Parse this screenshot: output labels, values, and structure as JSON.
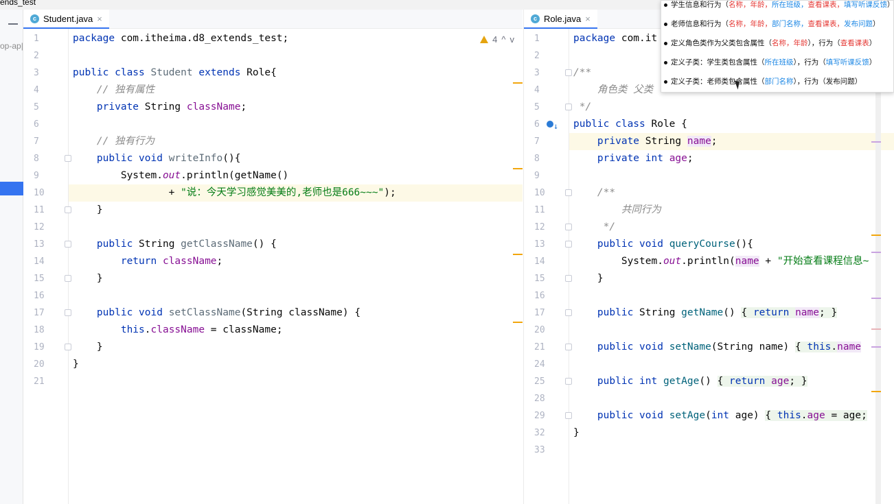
{
  "project_title": "ends_test",
  "left_strip": {
    "label": "op-ap|"
  },
  "left_editor": {
    "tab": {
      "icon": "c",
      "label": "Student.java",
      "close": "×"
    },
    "warnings": "4",
    "lines": [
      {
        "n": "1",
        "html": "<span class='kw'>package</span> com.itheima.d8_extends_test;"
      },
      {
        "n": "2",
        "html": ""
      },
      {
        "n": "3",
        "html": "<span class='kw'>public class</span> <span class='cls-grey'>Student</span> <span class='kw'>extends</span> Role{"
      },
      {
        "n": "4",
        "html": "    <span class='cmt'>// 独有属性</span>"
      },
      {
        "n": "5",
        "html": "    <span class='kw'>private</span> String <span class='fld'>className</span>;"
      },
      {
        "n": "6",
        "html": ""
      },
      {
        "n": "7",
        "html": "    <span class='cmt'>// 独有行为</span>"
      },
      {
        "n": "8",
        "html": "    <span class='kw'>public void</span> <span class='cls-grey'>writeInfo</span>(){"
      },
      {
        "n": "9",
        "html": "        System.<span class='ital'>out</span>.println(getName()"
      },
      {
        "n": "10",
        "html": "                + <span class='str'>\"说：今天学习感觉美美的,老师也是666~~~\"</span>);"
      },
      {
        "n": "11",
        "html": "    }"
      },
      {
        "n": "12",
        "html": ""
      },
      {
        "n": "13",
        "html": "    <span class='kw'>public</span> String <span class='cls-grey'>getClassName</span>() {"
      },
      {
        "n": "14",
        "html": "        <span class='kw'>return</span> <span class='fld'>className</span>;"
      },
      {
        "n": "15",
        "html": "    }"
      },
      {
        "n": "16",
        "html": ""
      },
      {
        "n": "17",
        "html": "    <span class='kw'>public void</span> <span class='cls-grey'>setClassName</span>(String className) {"
      },
      {
        "n": "18",
        "html": "        <span class='kw'>this</span>.<span class='fld'>className</span> = className;"
      },
      {
        "n": "19",
        "html": "    }"
      },
      {
        "n": "20",
        "html": "}"
      },
      {
        "n": "21",
        "html": ""
      }
    ]
  },
  "right_editor": {
    "tab": {
      "icon": "c",
      "label": "Role.java",
      "close": "×"
    },
    "lines": [
      {
        "n": "1",
        "html": "<span class='kw'>package</span> com.it"
      },
      {
        "n": "2",
        "html": ""
      },
      {
        "n": "3",
        "html": "<span class='cmt-doc'>/**</span>"
      },
      {
        "n": "4",
        "html": "<span class='cmt-doc'>    角色类 父类</span>"
      },
      {
        "n": "5",
        "html": "<span class='cmt-doc'> */</span>"
      },
      {
        "n": "6",
        "html": "<span class='kw'>public class</span> Role {"
      },
      {
        "n": "7",
        "html": "    <span class='kw'>private</span> String <span class='fld mark-bg'>name</span>;"
      },
      {
        "n": "8",
        "html": "    <span class='kw'>private int</span> <span class='fld'>age</span>;"
      },
      {
        "n": "9",
        "html": ""
      },
      {
        "n": "10",
        "html": "    <span class='cmt-doc'>/**</span>"
      },
      {
        "n": "11",
        "html": "<span class='cmt-doc'>        共同行为</span>"
      },
      {
        "n": "12",
        "html": "<span class='cmt-doc'>     */</span>"
      },
      {
        "n": "13",
        "html": "    <span class='kw'>public void</span> <span class='meth'>queryCourse</span>(){"
      },
      {
        "n": "14",
        "html": "        System.<span class='ital'>out</span>.println(<span class='fld mark-bg'>name</span> + <span class='str'>\"开始查看课程信息~</span>"
      },
      {
        "n": "15",
        "html": "    }"
      },
      {
        "n": "16",
        "html": ""
      },
      {
        "n": "17",
        "html": "    <span class='kw'>public</span> String <span class='meth'>getName</span>() <span class='fold-bg'>{ <span class='kw'>return</span> <span class='fld mark-bg'>name</span>; }</span>"
      },
      {
        "n": "20",
        "html": ""
      },
      {
        "n": "21",
        "html": "    <span class='kw'>public void</span> <span class='meth'>setName</span>(String name) <span class='fold-bg'>{ <span class='kw'>this</span>.<span class='fld mark-bg'>name</span></span>"
      },
      {
        "n": "24",
        "html": ""
      },
      {
        "n": "25",
        "html": "    <span class='kw'>public int</span> <span class='meth'>getAge</span>() <span class='fold-bg'>{ <span class='kw'>return</span> <span class='fld'>age</span>; }</span>"
      },
      {
        "n": "28",
        "html": ""
      },
      {
        "n": "29",
        "html": "    <span class='kw'>public void</span> <span class='meth'>setAge</span>(<span class='kw'>int</span> age) <span class='fold-bg'>{ <span class='kw'>this</span>.<span class='fld'>age</span> = age;</span>"
      },
      {
        "n": "32",
        "html": "}"
      },
      {
        "n": "33",
        "html": ""
      }
    ]
  },
  "tooltip": {
    "rows": [
      {
        "html": "学生信息和行为（<span class='red'>名称，年龄，</span><span class='blue'>所在班级，</span><span class='red'>查看课表，</span><span class='blue'>填写听课反馈</span>）"
      },
      {
        "html": "老师信息和行为（<span class='red'>名称，年龄，</span><span class='blue'>部门名称，</span><span class='red'>查看课表，</span><span class='blue'>发布问题</span>）"
      },
      {
        "html": "定义角色类作为父类包含属性（<span class='red'>名称，年龄</span>），行为（<span class='red'>查看课表</span>）"
      },
      {
        "html": "定义子类：学生类包含属性（<span class='blue'>所在班级</span>），行为（<span class='blue'>填写听课反馈</span>）"
      },
      {
        "html": "定义子类：老师类包含属性（<span class='blue'>部门名称</span>），行为（发布问题）"
      }
    ]
  },
  "colors": {
    "accent": "#3574f0",
    "keyword": "#0033b3",
    "field": "#871094",
    "string": "#067d17",
    "red": "#e53935",
    "blue": "#1e88e5"
  }
}
